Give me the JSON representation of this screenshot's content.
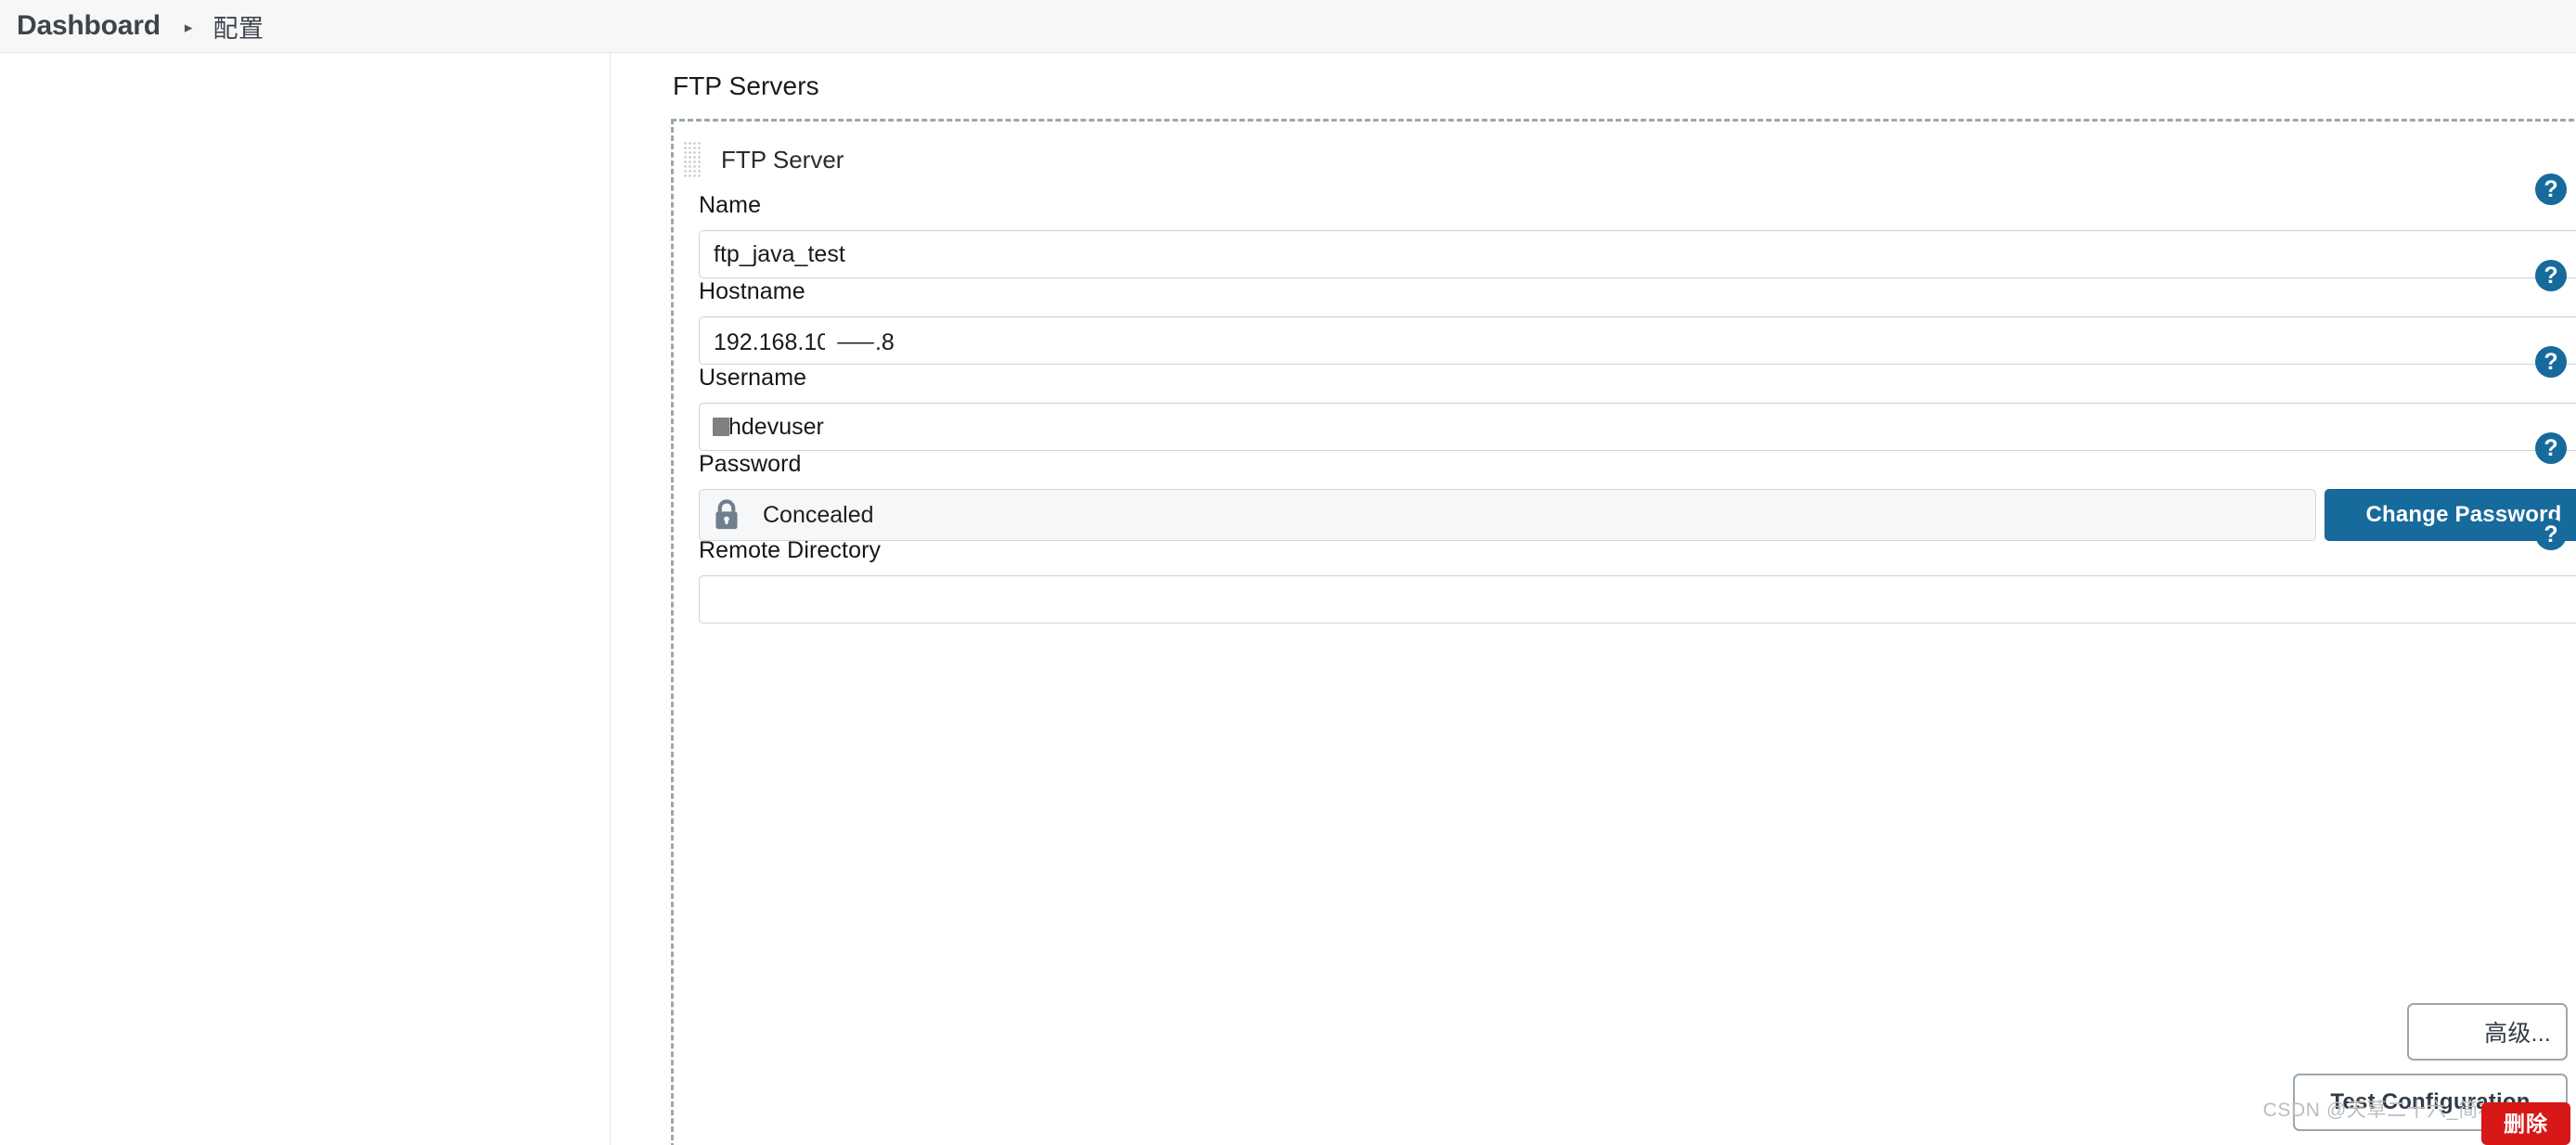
{
  "breadcrumb": {
    "root": "Dashboard",
    "separator": "▸",
    "leaf": "配置"
  },
  "section": {
    "title": "FTP Servers"
  },
  "block": {
    "title": "FTP Server",
    "drag_handle_icon": "drag-grip-icon"
  },
  "fields": {
    "name": {
      "label": "Name",
      "value": "ftp_java_test",
      "placeholder": "",
      "help_icon": "help-circle-icon"
    },
    "hostname": {
      "label": "Hostname",
      "value": "192.168.10.⸺.8",
      "placeholder": "",
      "help_icon": "help-circle-icon"
    },
    "username": {
      "label": "Username",
      "value": "hdevuser",
      "placeholder": "",
      "help_icon": "help-circle-icon"
    },
    "password": {
      "label": "Password",
      "value": "Concealed",
      "lock_icon": "lock-icon",
      "change_button": "Change Password",
      "help_icon": "help-circle-icon"
    },
    "remote_directory": {
      "label": "Remote Directory",
      "value": "",
      "placeholder": "",
      "help_icon": "help-circle-icon"
    }
  },
  "buttons": {
    "advanced": "高级...",
    "test_configuration": "Test Configuration"
  },
  "watermark": {
    "text": "CSDN @天草二十六_简村人",
    "badge": "删除"
  },
  "colors": {
    "accent_blue": "#176a9c",
    "dashed_border": "#9aa7b0",
    "header_bg": "#f7f7f7",
    "badge_red": "#d81717",
    "lock_gray": "#6e7f8d"
  }
}
